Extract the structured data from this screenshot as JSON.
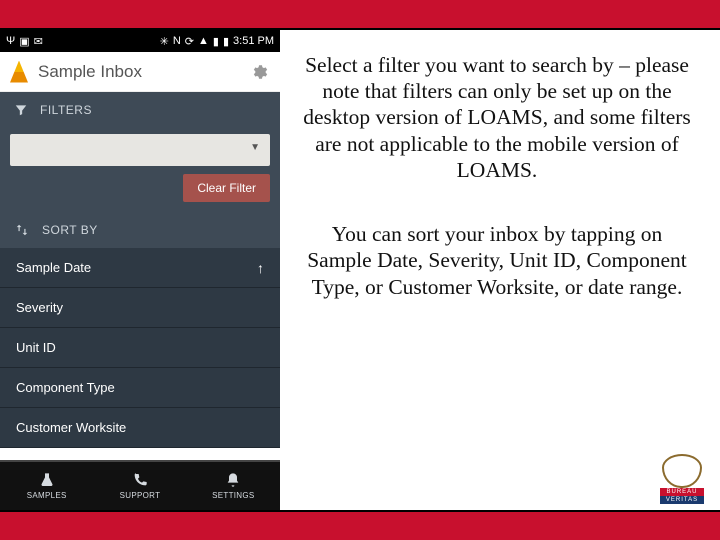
{
  "statusbar": {
    "time": "3:51 PM"
  },
  "app": {
    "title": "Sample Inbox",
    "filters_label": "FILTERS",
    "clear_label": "Clear Filter",
    "sortby_label": "SORT BY"
  },
  "sort_items": [
    {
      "label": "Sample Date",
      "arrow": true
    },
    {
      "label": "Severity",
      "arrow": false
    },
    {
      "label": "Unit ID",
      "arrow": false
    },
    {
      "label": "Component Type",
      "arrow": false
    },
    {
      "label": "Customer Worksite",
      "arrow": false
    }
  ],
  "nav": {
    "samples": "SAMPLES",
    "support": "SUPPORT",
    "settings": "SETTINGS"
  },
  "text": {
    "p1": "Select a filter you want to search by – please note that filters can only be set up on the desktop version of LOAMS, and some filters are not applicable to the mobile version of LOAMS.",
    "p2": "You can sort your inbox by tapping on Sample Date, Severity, Unit ID, Component Type, or Customer Worksite, or date range."
  },
  "logo": {
    "line1": "BUREAU",
    "line2": "VERITAS"
  }
}
